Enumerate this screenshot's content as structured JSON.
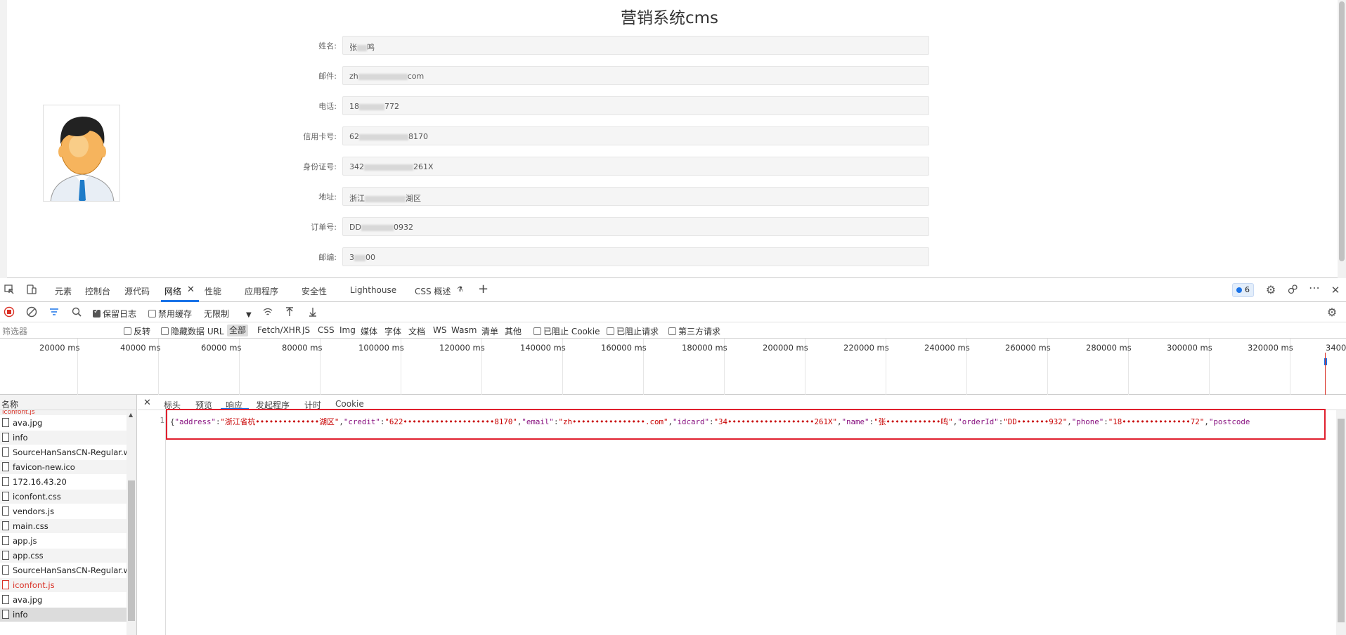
{
  "page": {
    "title": "营销系统cms",
    "fields": [
      {
        "label": "姓名:",
        "value_start": "张",
        "value_end": "鸣"
      },
      {
        "label": "邮件:",
        "value_start": "zh",
        "value_end": "com"
      },
      {
        "label": "电话:",
        "value_start": "18",
        "value_end": "772"
      },
      {
        "label": "信用卡号:",
        "value_start": "62",
        "value_end": "8170"
      },
      {
        "label": "身份证号:",
        "value_start": "342",
        "value_end": "261X"
      },
      {
        "label": "地址:",
        "value_start": "浙江",
        "value_end": "湖区"
      },
      {
        "label": "订单号:",
        "value_start": "DD",
        "value_end": "0932"
      },
      {
        "label": "邮编:",
        "value_start": "3",
        "value_end": "00"
      }
    ]
  },
  "devtools": {
    "tabs": [
      "元素",
      "控制台",
      "源代码",
      "网络",
      "性能",
      "应用程序",
      "安全性",
      "Lighthouse",
      "CSS 概述"
    ],
    "active_tab": "网络",
    "issues_count": "6",
    "toolbar": {
      "preserve_log": "保留日志",
      "disable_cache": "禁用缓存",
      "throttle": "无限制"
    },
    "filter": {
      "placeholder": "筛选器",
      "invert": "反转",
      "hide_data_urls": "隐藏数据 URL",
      "types": [
        "全部",
        "Fetch/XHR",
        "JS",
        "CSS",
        "Img",
        "媒体",
        "字体",
        "文档",
        "WS",
        "Wasm",
        "清单",
        "其他"
      ],
      "blocked_cookies": "已阻止 Cookie",
      "blocked_requests": "已阻止请求",
      "third_party": "第三方请求"
    },
    "timeline_ticks": [
      "20000 ms",
      "40000 ms",
      "60000 ms",
      "80000 ms",
      "100000 ms",
      "120000 ms",
      "140000 ms",
      "160000 ms",
      "180000 ms",
      "200000 ms",
      "220000 ms",
      "240000 ms",
      "260000 ms",
      "280000 ms",
      "300000 ms",
      "320000 ms",
      "3400"
    ],
    "name_header": "名称",
    "requests": [
      {
        "name": "ava.jpg",
        "red": false
      },
      {
        "name": "info",
        "red": false
      },
      {
        "name": "SourceHanSansCN-Regular.w...",
        "red": false
      },
      {
        "name": "favicon-new.ico",
        "red": false
      },
      {
        "name": "172.16.43.20",
        "red": false
      },
      {
        "name": "iconfont.css",
        "red": false
      },
      {
        "name": "vendors.js",
        "red": false
      },
      {
        "name": "main.css",
        "red": false
      },
      {
        "name": "app.js",
        "red": false
      },
      {
        "name": "app.css",
        "red": false
      },
      {
        "name": "SourceHanSansCN-Regular.w...",
        "red": false
      },
      {
        "name": "iconfont.js",
        "red": true
      },
      {
        "name": "ava.jpg",
        "red": false
      },
      {
        "name": "info",
        "red": false
      }
    ],
    "detail_tabs": [
      "标头",
      "预览",
      "响应",
      "发起程序",
      "计时",
      "Cookie"
    ],
    "active_detail_tab": "响应",
    "response": {
      "line_number": "1",
      "segments": [
        {
          "t": "p",
          "v": "{"
        },
        {
          "t": "k",
          "v": "\"address\""
        },
        {
          "t": "p",
          "v": ":"
        },
        {
          "t": "s",
          "v": "\"浙江省杭••••••••••••••湖区\""
        },
        {
          "t": "p",
          "v": ","
        },
        {
          "t": "k",
          "v": "\"credit\""
        },
        {
          "t": "p",
          "v": ":"
        },
        {
          "t": "s",
          "v": "\"622••••••••••••••••••••8170\""
        },
        {
          "t": "p",
          "v": ","
        },
        {
          "t": "k",
          "v": "\"email\""
        },
        {
          "t": "p",
          "v": ":"
        },
        {
          "t": "s",
          "v": "\"zh••••••••••••••••.com\""
        },
        {
          "t": "p",
          "v": ","
        },
        {
          "t": "k",
          "v": "\"idcard\""
        },
        {
          "t": "p",
          "v": ":"
        },
        {
          "t": "s",
          "v": "\"34•••••••••••••••••••261X\""
        },
        {
          "t": "p",
          "v": ","
        },
        {
          "t": "k",
          "v": "\"name\""
        },
        {
          "t": "p",
          "v": ":"
        },
        {
          "t": "s",
          "v": "\"张••••••••••••鸣\""
        },
        {
          "t": "p",
          "v": ","
        },
        {
          "t": "k",
          "v": "\"orderId\""
        },
        {
          "t": "p",
          "v": ":"
        },
        {
          "t": "s",
          "v": "\"DD•••••••932\""
        },
        {
          "t": "p",
          "v": ","
        },
        {
          "t": "k",
          "v": "\"phone\""
        },
        {
          "t": "p",
          "v": ":"
        },
        {
          "t": "s",
          "v": "\"18•••••••••••••••72\""
        },
        {
          "t": "p",
          "v": ","
        },
        {
          "t": "k",
          "v": "\"postcode"
        }
      ]
    },
    "colors": {
      "highlight_box": "#e0202e",
      "accent": "#1a73e8",
      "string": "#c80000",
      "key": "#881280"
    }
  }
}
